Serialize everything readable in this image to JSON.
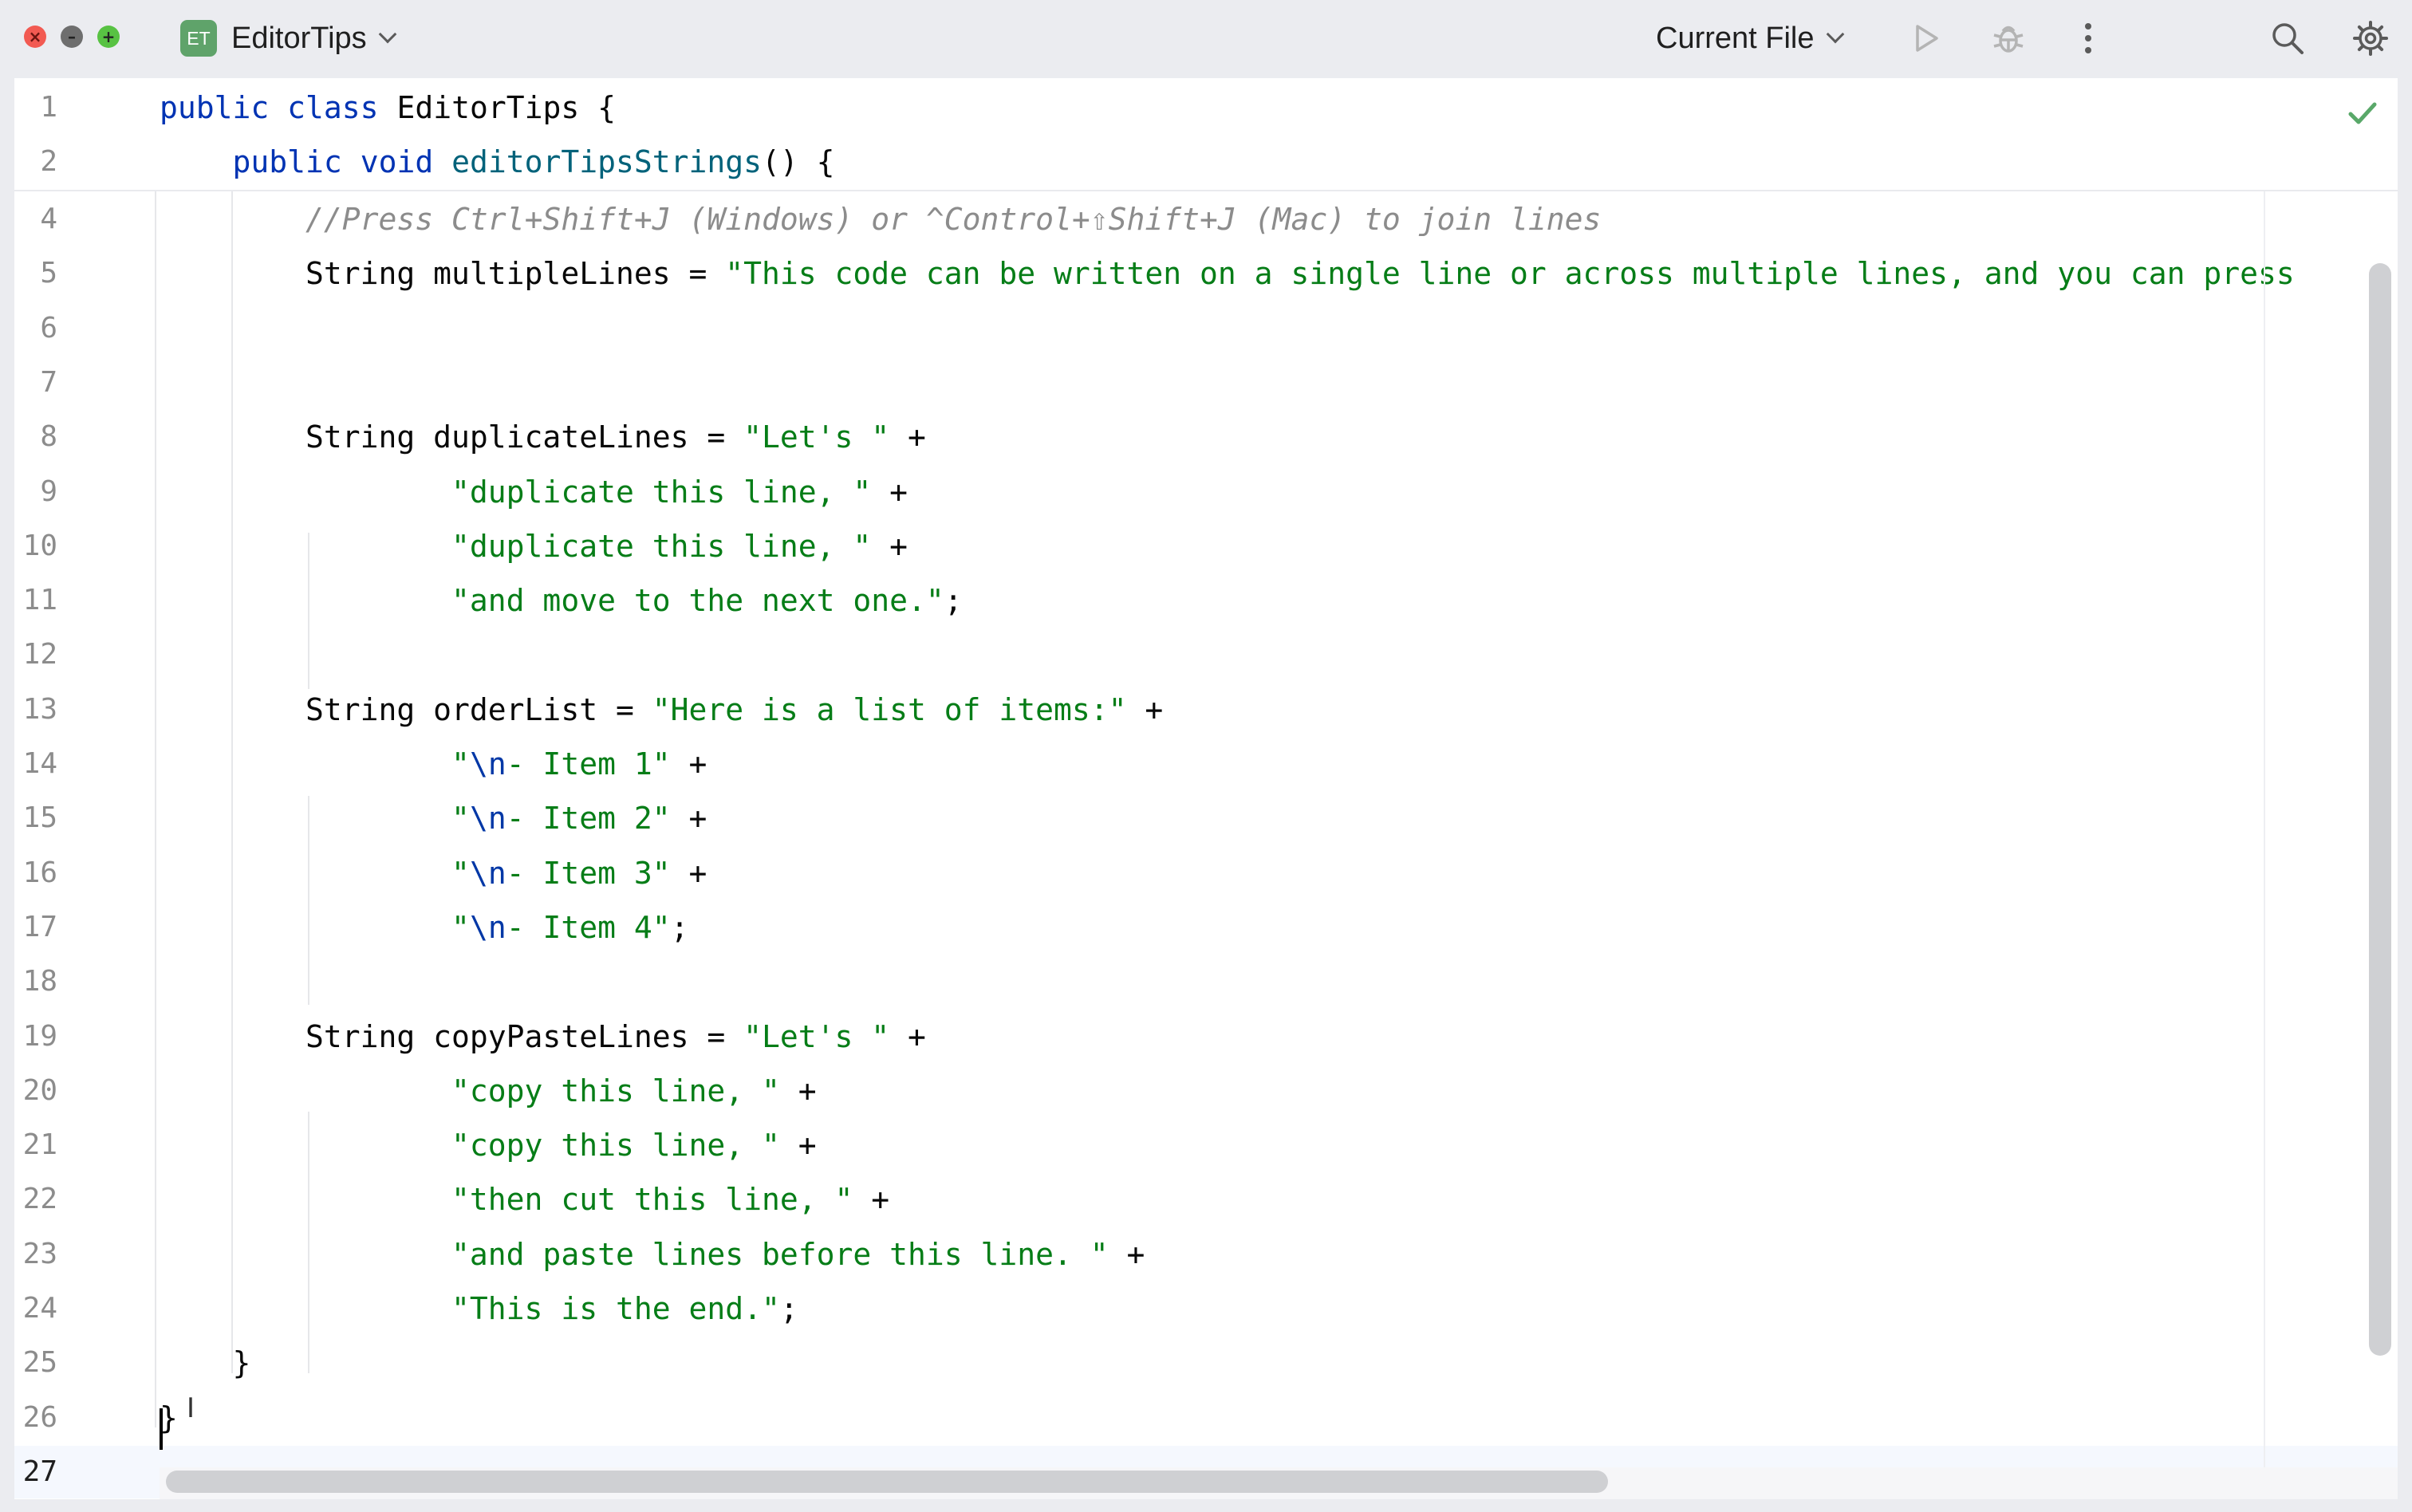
{
  "window": {
    "project_badge": "ET",
    "project_name": "EditorTips",
    "run_configuration": "Current File",
    "icons": [
      "close-icon",
      "minimize-icon",
      "zoom-icon",
      "run-icon",
      "debug-icon",
      "more-icon",
      "search-icon",
      "settings-icon"
    ]
  },
  "colors": {
    "keyword": "#0033b3",
    "method": "#00627a",
    "string": "#067d17",
    "escape": "#0037a6",
    "comment": "#8c8c8c",
    "text": "#080808",
    "status_check": "#59a869"
  },
  "editor": {
    "status_icon": "check-icon",
    "current_line": 27,
    "sticky_lines": [
      {
        "n": "1",
        "tokens": [
          {
            "t": "public",
            "c": "kw"
          },
          {
            "t": " "
          },
          {
            "t": "class",
            "c": "kw"
          },
          {
            "t": " EditorTips {"
          }
        ]
      },
      {
        "n": "2",
        "tokens": [
          {
            "t": "    "
          },
          {
            "t": "public",
            "c": "kw"
          },
          {
            "t": " "
          },
          {
            "t": "void",
            "c": "kw"
          },
          {
            "t": " "
          },
          {
            "t": "editorTipsStrings",
            "c": "fn"
          },
          {
            "t": "() {"
          }
        ]
      }
    ],
    "lines": [
      {
        "n": "4",
        "tokens": [
          {
            "t": "        "
          },
          {
            "t": "//Press Ctrl+Shift+J (Windows) or ^Control+⇧Shift+J (Mac) to join lines",
            "c": "cmt"
          }
        ]
      },
      {
        "n": "5",
        "tokens": [
          {
            "t": "        String multipleLines = "
          },
          {
            "t": "\"This code can be written on a single line or across multiple lines, and you can press",
            "c": "str"
          }
        ]
      },
      {
        "n": "6",
        "tokens": []
      },
      {
        "n": "7",
        "tokens": []
      },
      {
        "n": "8",
        "tokens": [
          {
            "t": "        String duplicateLines = "
          },
          {
            "t": "\"Let's \"",
            "c": "str"
          },
          {
            "t": " +"
          }
        ]
      },
      {
        "n": "9",
        "tokens": [
          {
            "t": "                "
          },
          {
            "t": "\"duplicate this line, \"",
            "c": "str"
          },
          {
            "t": " +"
          }
        ]
      },
      {
        "n": "10",
        "tokens": [
          {
            "t": "                "
          },
          {
            "t": "\"duplicate this line, \"",
            "c": "str"
          },
          {
            "t": " +"
          }
        ]
      },
      {
        "n": "11",
        "tokens": [
          {
            "t": "                "
          },
          {
            "t": "\"and move to the next one.\"",
            "c": "str"
          },
          {
            "t": ";"
          }
        ]
      },
      {
        "n": "12",
        "tokens": []
      },
      {
        "n": "13",
        "tokens": [
          {
            "t": "        String orderList = "
          },
          {
            "t": "\"Here is a list of items:\"",
            "c": "str"
          },
          {
            "t": " +"
          }
        ]
      },
      {
        "n": "14",
        "tokens": [
          {
            "t": "                "
          },
          {
            "t": "\"",
            "c": "str"
          },
          {
            "t": "\\n",
            "c": "esc"
          },
          {
            "t": "- Item 1\"",
            "c": "str"
          },
          {
            "t": " +"
          }
        ]
      },
      {
        "n": "15",
        "tokens": [
          {
            "t": "                "
          },
          {
            "t": "\"",
            "c": "str"
          },
          {
            "t": "\\n",
            "c": "esc"
          },
          {
            "t": "- Item 2\"",
            "c": "str"
          },
          {
            "t": " +"
          }
        ]
      },
      {
        "n": "16",
        "tokens": [
          {
            "t": "                "
          },
          {
            "t": "\"",
            "c": "str"
          },
          {
            "t": "\\n",
            "c": "esc"
          },
          {
            "t": "- Item 3\"",
            "c": "str"
          },
          {
            "t": " +"
          }
        ]
      },
      {
        "n": "17",
        "tokens": [
          {
            "t": "                "
          },
          {
            "t": "\"",
            "c": "str"
          },
          {
            "t": "\\n",
            "c": "esc"
          },
          {
            "t": "- Item 4\"",
            "c": "str"
          },
          {
            "t": ";"
          }
        ]
      },
      {
        "n": "18",
        "tokens": []
      },
      {
        "n": "19",
        "tokens": [
          {
            "t": "        String copyPasteLines = "
          },
          {
            "t": "\"Let's \"",
            "c": "str"
          },
          {
            "t": " +"
          }
        ]
      },
      {
        "n": "20",
        "tokens": [
          {
            "t": "                "
          },
          {
            "t": "\"copy this line, \"",
            "c": "str"
          },
          {
            "t": " +"
          }
        ]
      },
      {
        "n": "21",
        "tokens": [
          {
            "t": "                "
          },
          {
            "t": "\"copy this line, \"",
            "c": "str"
          },
          {
            "t": " +"
          }
        ]
      },
      {
        "n": "22",
        "tokens": [
          {
            "t": "                "
          },
          {
            "t": "\"then cut this line, \"",
            "c": "str"
          },
          {
            "t": " +"
          }
        ]
      },
      {
        "n": "23",
        "tokens": [
          {
            "t": "                "
          },
          {
            "t": "\"and paste lines before this line. \"",
            "c": "str"
          },
          {
            "t": " +"
          }
        ]
      },
      {
        "n": "24",
        "tokens": [
          {
            "t": "                "
          },
          {
            "t": "\"This is the end.\"",
            "c": "str"
          },
          {
            "t": ";"
          }
        ]
      },
      {
        "n": "25",
        "tokens": [
          {
            "t": "    }"
          }
        ]
      },
      {
        "n": "26",
        "tokens": [
          {
            "t": "}"
          }
        ]
      },
      {
        "n": "27",
        "tokens": []
      }
    ]
  }
}
